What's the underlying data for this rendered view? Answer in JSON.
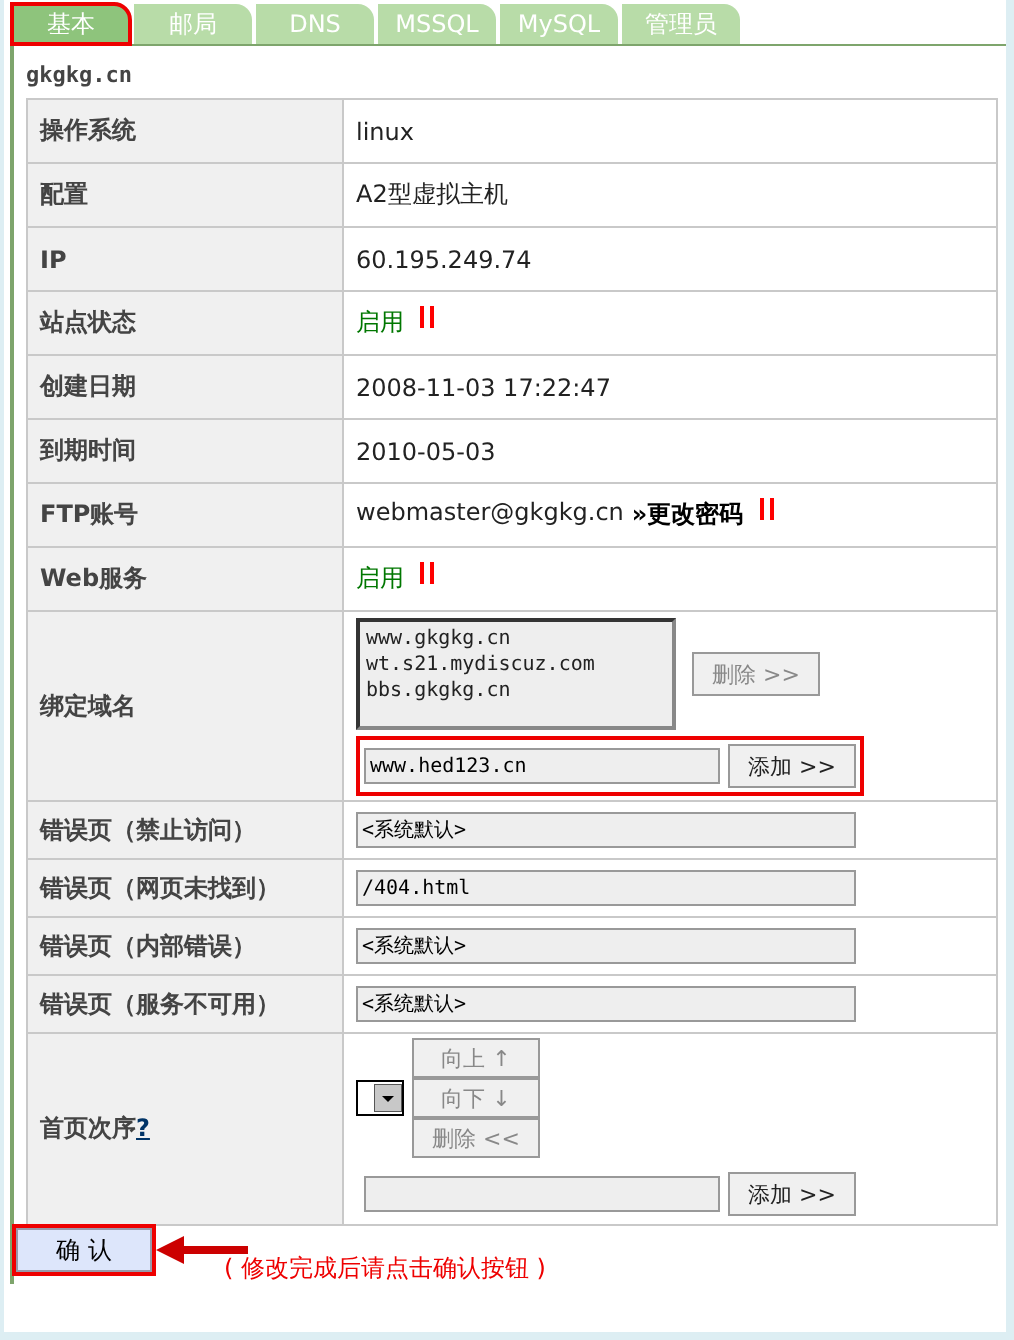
{
  "tabs": [
    {
      "label": "基本",
      "selected": true,
      "highlighted": true
    },
    {
      "label": "邮局",
      "selected": false,
      "highlighted": false
    },
    {
      "label": "DNS",
      "selected": false,
      "highlighted": false
    },
    {
      "label": "MSSQL",
      "selected": false,
      "highlighted": false
    },
    {
      "label": "MySQL",
      "selected": false,
      "highlighted": false
    },
    {
      "label": "管理员",
      "selected": false,
      "highlighted": false
    }
  ],
  "site_title": "gkgkg.cn",
  "rows": [
    {
      "kind": "text",
      "label": "操作系统",
      "value": "linux"
    },
    {
      "kind": "text",
      "label": "配置",
      "value": "A2型虚拟主机"
    },
    {
      "kind": "text",
      "label": "IP",
      "value": "60.195.249.74"
    },
    {
      "kind": "status",
      "label": "站点状态",
      "value": "启用",
      "paused": false
    },
    {
      "kind": "text",
      "label": "创建日期",
      "value": "2008-11-03 17:22:47"
    },
    {
      "kind": "text",
      "label": "到期时间",
      "value": "2010-05-03"
    },
    {
      "kind": "ftp",
      "label": "FTP账号",
      "value": "webmaster@gkgkg.cn",
      "link": "»更改密码"
    },
    {
      "kind": "status",
      "label": "Web服务",
      "value": "启用",
      "paused": false
    },
    {
      "kind": "domains",
      "label": "绑定域名",
      "domains": [
        "www.gkgkg.cn",
        "wt.s21.mydiscuz.com",
        "bbs.gkgkg.cn"
      ],
      "remove_button": {
        "label": "删除 >>",
        "disabled": true
      },
      "input": "www.hed123.cn",
      "add_button": "添加 >>",
      "highlighted": true
    },
    {
      "kind": "input",
      "label": "错误页（禁止访问）",
      "value": "<系统默认>"
    },
    {
      "kind": "input",
      "label": "错误页（网页未找到）",
      "value": "/404.html"
    },
    {
      "kind": "input",
      "label": "错误页（内部错误）",
      "value": "<系统默认>"
    },
    {
      "kind": "input",
      "label": "错误页（服务不可用）",
      "value": "<系统默认>"
    },
    {
      "kind": "order",
      "label": "首页次序",
      "help": "?",
      "buttons": [
        {
          "label": "向上 ↑",
          "disabled": true
        },
        {
          "label": "向下 ↓",
          "disabled": true
        },
        {
          "label": "删除 <<",
          "disabled": true
        }
      ],
      "add_button": "添加 >>"
    }
  ],
  "confirm": {
    "label": "确 认",
    "highlighted": true
  },
  "note": "( 修改完成后请点击确认按钮 )"
}
